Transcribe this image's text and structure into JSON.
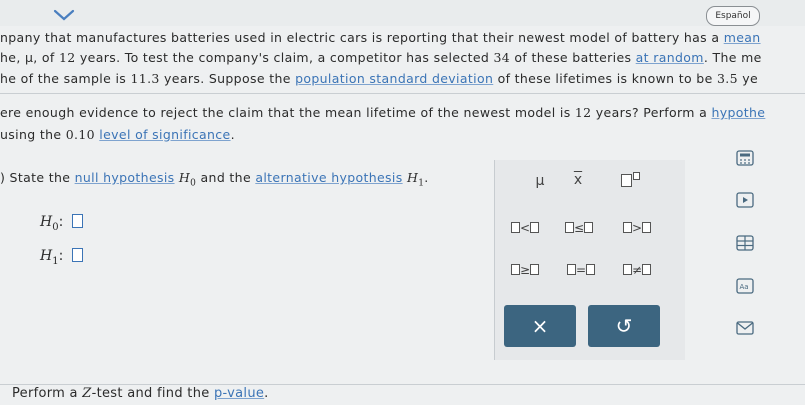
{
  "header": {
    "language_button": "Español"
  },
  "problem": {
    "line1_text": "npany that manufactures batteries used in electric cars is reporting that their newest model of battery has a ",
    "line1_link": "mean",
    "line2_a": "he, μ, of ",
    "line2_num": "12",
    "line2_b": " years. To test the company's claim, a competitor has selected ",
    "line2_num2": "34",
    "line2_c": " of these batteries ",
    "line2_link": "at random",
    "line2_d": ". The me",
    "line3_a": "he of the sample is ",
    "line3_num": "11.3",
    "line3_b": " years. Suppose the ",
    "line3_link": "population standard deviation",
    "line3_c": " of these lifetimes is known to be ",
    "line3_num2": "3.5",
    "line3_d": " ye",
    "line4_a": "ere enough evidence to reject the claim that the mean lifetime of the newest model is ",
    "line4_num": "12",
    "line4_b": " years? Perform a ",
    "line4_link": "hypothe",
    "line5_a": "using the ",
    "line5_num": "0.10",
    "line5_link": "level of significance",
    "line5_b": "."
  },
  "part_a": {
    "prefix": ") State the ",
    "link1": "null hypothesis",
    "h0_symbol": "H",
    "h0_sub": "0",
    "middle": " and the ",
    "link2": "alternative hypothesis",
    "h1_symbol": "H",
    "h1_sub": "1",
    "end": ".",
    "h0_label": "H",
    "h0_label_sub": "0",
    "h1_label": "H",
    "h1_label_sub": "1",
    "colon": ":"
  },
  "palette": {
    "mu": "μ",
    "xbar": "x",
    "lt": "<",
    "le": "≤",
    "gt": ">",
    "ge": "≥",
    "eq": "=",
    "ne": "≠",
    "clear_button": "×",
    "undo_button": "↺"
  },
  "footer": {
    "text_a": "Perform a ",
    "z": "Z",
    "text_b": "-test and find the ",
    "link": "p-value",
    "text_c": "."
  },
  "icons": [
    "chevron-down-icon",
    "calculator-icon",
    "play-icon",
    "table-icon",
    "text-aa-icon",
    "mail-icon"
  ]
}
